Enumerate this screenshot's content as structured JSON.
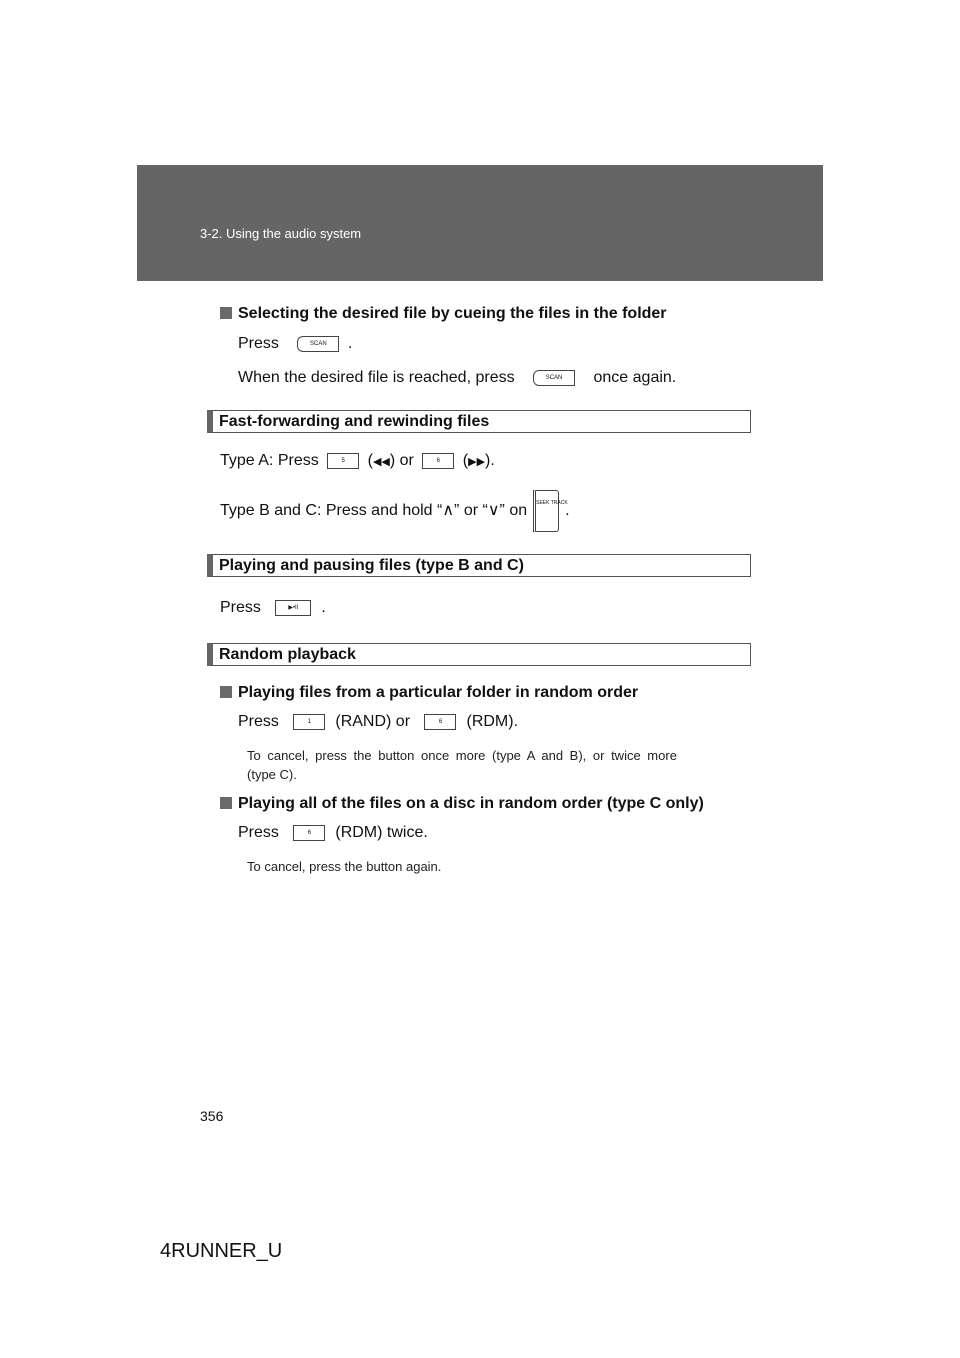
{
  "header": {
    "breadcrumb": "3-2. Using the audio system"
  },
  "keys": {
    "scan": "SCAN",
    "five": "5",
    "six": "6",
    "one": "1",
    "play_pause": "▶•II",
    "seek_track": "SEEK TRACK",
    "rewind": "◀◀",
    "ffwd": "▶▶"
  },
  "s1": {
    "heading": "Selecting the desired file by cueing the files in the folder",
    "line1a": "Press",
    "line1b": ".",
    "line2a": "When the desired file is reached, press",
    "line2b": "once again."
  },
  "sec_ff": {
    "title": "Fast-forwarding and rewinding files",
    "typeA_a": "Type A: Press",
    "typeA_b": "(",
    "typeA_c": ") or",
    "typeA_d": "(",
    "typeA_e": ").",
    "typeBC_a": "Type B and C: Press and hold “∧” or “∨” on",
    "typeBC_b": "."
  },
  "sec_play": {
    "title": "Playing and pausing files (type B and C)",
    "press": "Press",
    "end": "."
  },
  "sec_rand": {
    "title": "Random playback",
    "sub1": {
      "heading": "Playing files from a particular folder in random order",
      "press": "Press",
      "rand": "(RAND) or",
      "rdm": "(RDM).",
      "note": "To cancel, press the button once more (type A and B), or twice more",
      "note2": "(type C)."
    },
    "sub2": {
      "heading": "Playing all of the files on a disc in random order (type C only)",
      "press": "Press",
      "rdm": "(RDM) twice.",
      "note": "To cancel, press the button again."
    }
  },
  "page_number": "356",
  "footer": "4RUNNER_U"
}
